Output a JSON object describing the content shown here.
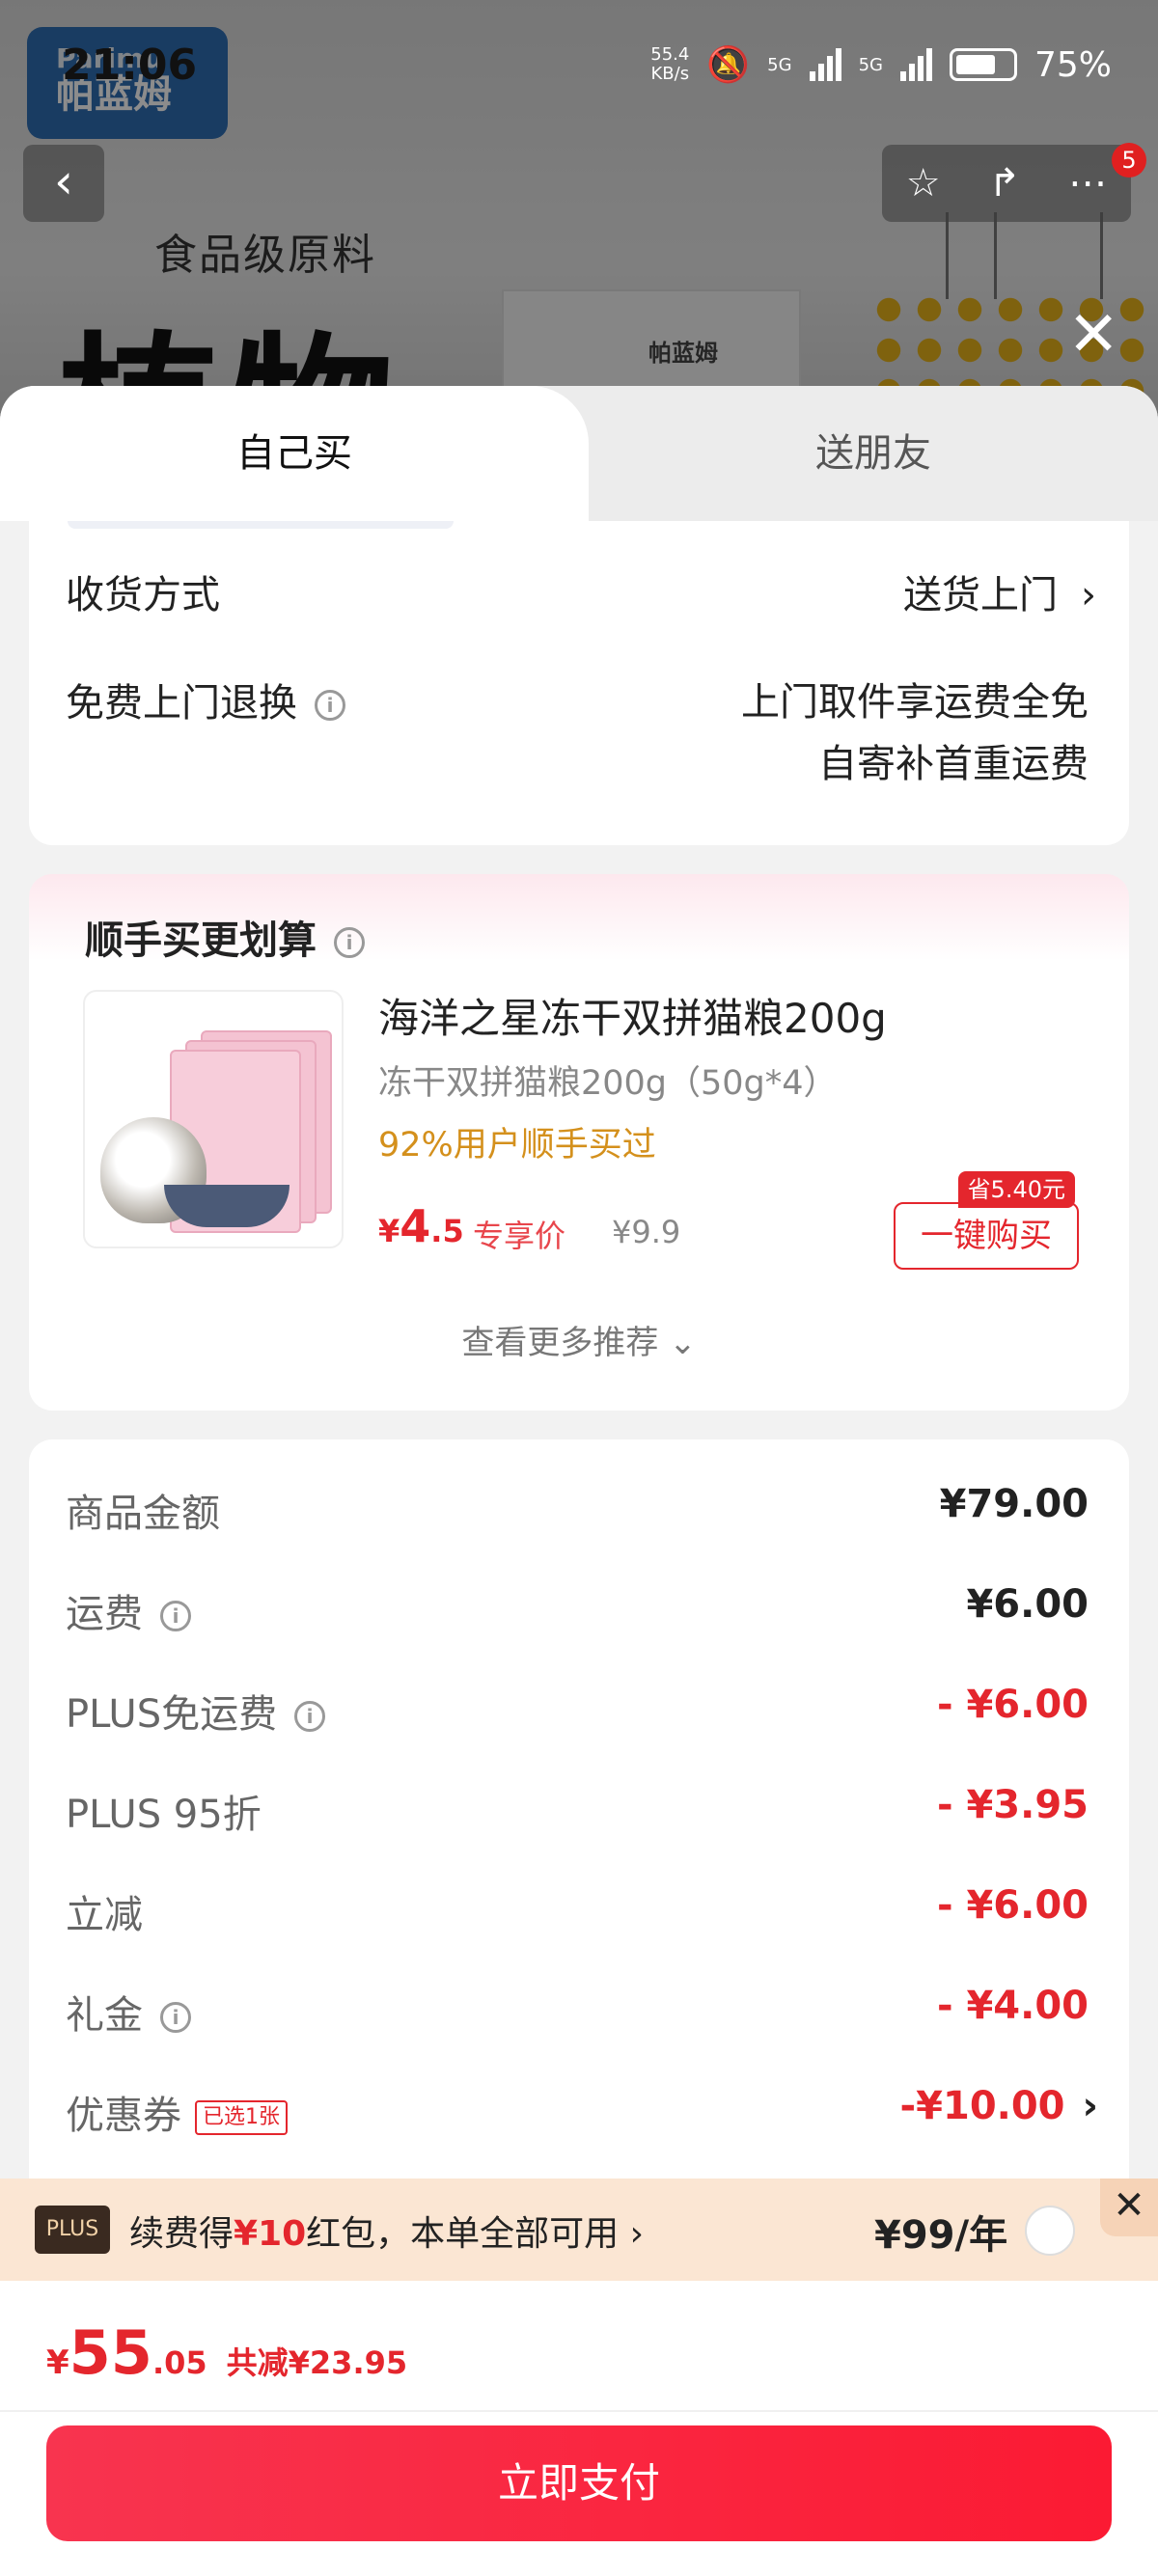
{
  "status_bar": {
    "time": "21:06",
    "net_speed": "55.4\nKB/s",
    "net_top": "55.4",
    "net_bottom": "KB/s",
    "sim1": "5G",
    "sim2": "5G",
    "battery": "75%"
  },
  "background": {
    "brand_latin": "Parimu",
    "brand_cn": "帕蓝姆",
    "headline_small": "食品级原料",
    "headline_big": "植物",
    "bag_brand": "帕蓝姆",
    "cart_badge": "5"
  },
  "tabs": {
    "self": "自己买",
    "gift": "送朋友"
  },
  "delivery": {
    "method_label": "收货方式",
    "method_value": "送货上门",
    "return_label": "免费上门退换",
    "return_line1": "上门取件享运费全免",
    "return_line2": "自寄补首重运费"
  },
  "bundle": {
    "title": "顺手买更划算",
    "product_name": "海洋之星冻干双拼猫粮200g",
    "product_spec": "冻干双拼猫粮200g（50g*4）",
    "bought_rate": "92%用户顺手买过",
    "currency": "¥",
    "price_int": "4",
    "price_dec": ".5",
    "price_tag": "专享价",
    "orig_price": "¥9.9",
    "save_tag": "省5.40元",
    "buy_label": "一键购买",
    "more_label": "查看更多推荐 ⌄"
  },
  "amounts": {
    "rows": [
      {
        "label": "商品金额",
        "value": "¥79.00"
      },
      {
        "label": "运费",
        "value": "¥6.00"
      },
      {
        "label": "PLUS免运费",
        "value": "- ¥6.00"
      },
      {
        "label": "PLUS 95折",
        "value": "- ¥3.95"
      },
      {
        "label": "立减",
        "value": "- ¥6.00"
      },
      {
        "label": "礼金",
        "value": "- ¥4.00"
      },
      {
        "label": "优惠券",
        "value": "-¥10.00"
      }
    ],
    "coupon_badge": "已选1张"
  },
  "plus": {
    "logo": "PLUS",
    "text_prefix": "续费得",
    "text_highlight": "¥10",
    "text_suffix": "红包，本单全部可用 ›",
    "price": "¥99/年",
    "close": "✕"
  },
  "footer": {
    "currency": "¥",
    "total_int": "55",
    "total_dec": ".05",
    "saved": "共减¥23.95",
    "pay_label": "立即支付"
  },
  "colors": {
    "accent": "#e4262d",
    "pay_button": "#fb1a33",
    "plus_bar": "#fbe6d3"
  }
}
